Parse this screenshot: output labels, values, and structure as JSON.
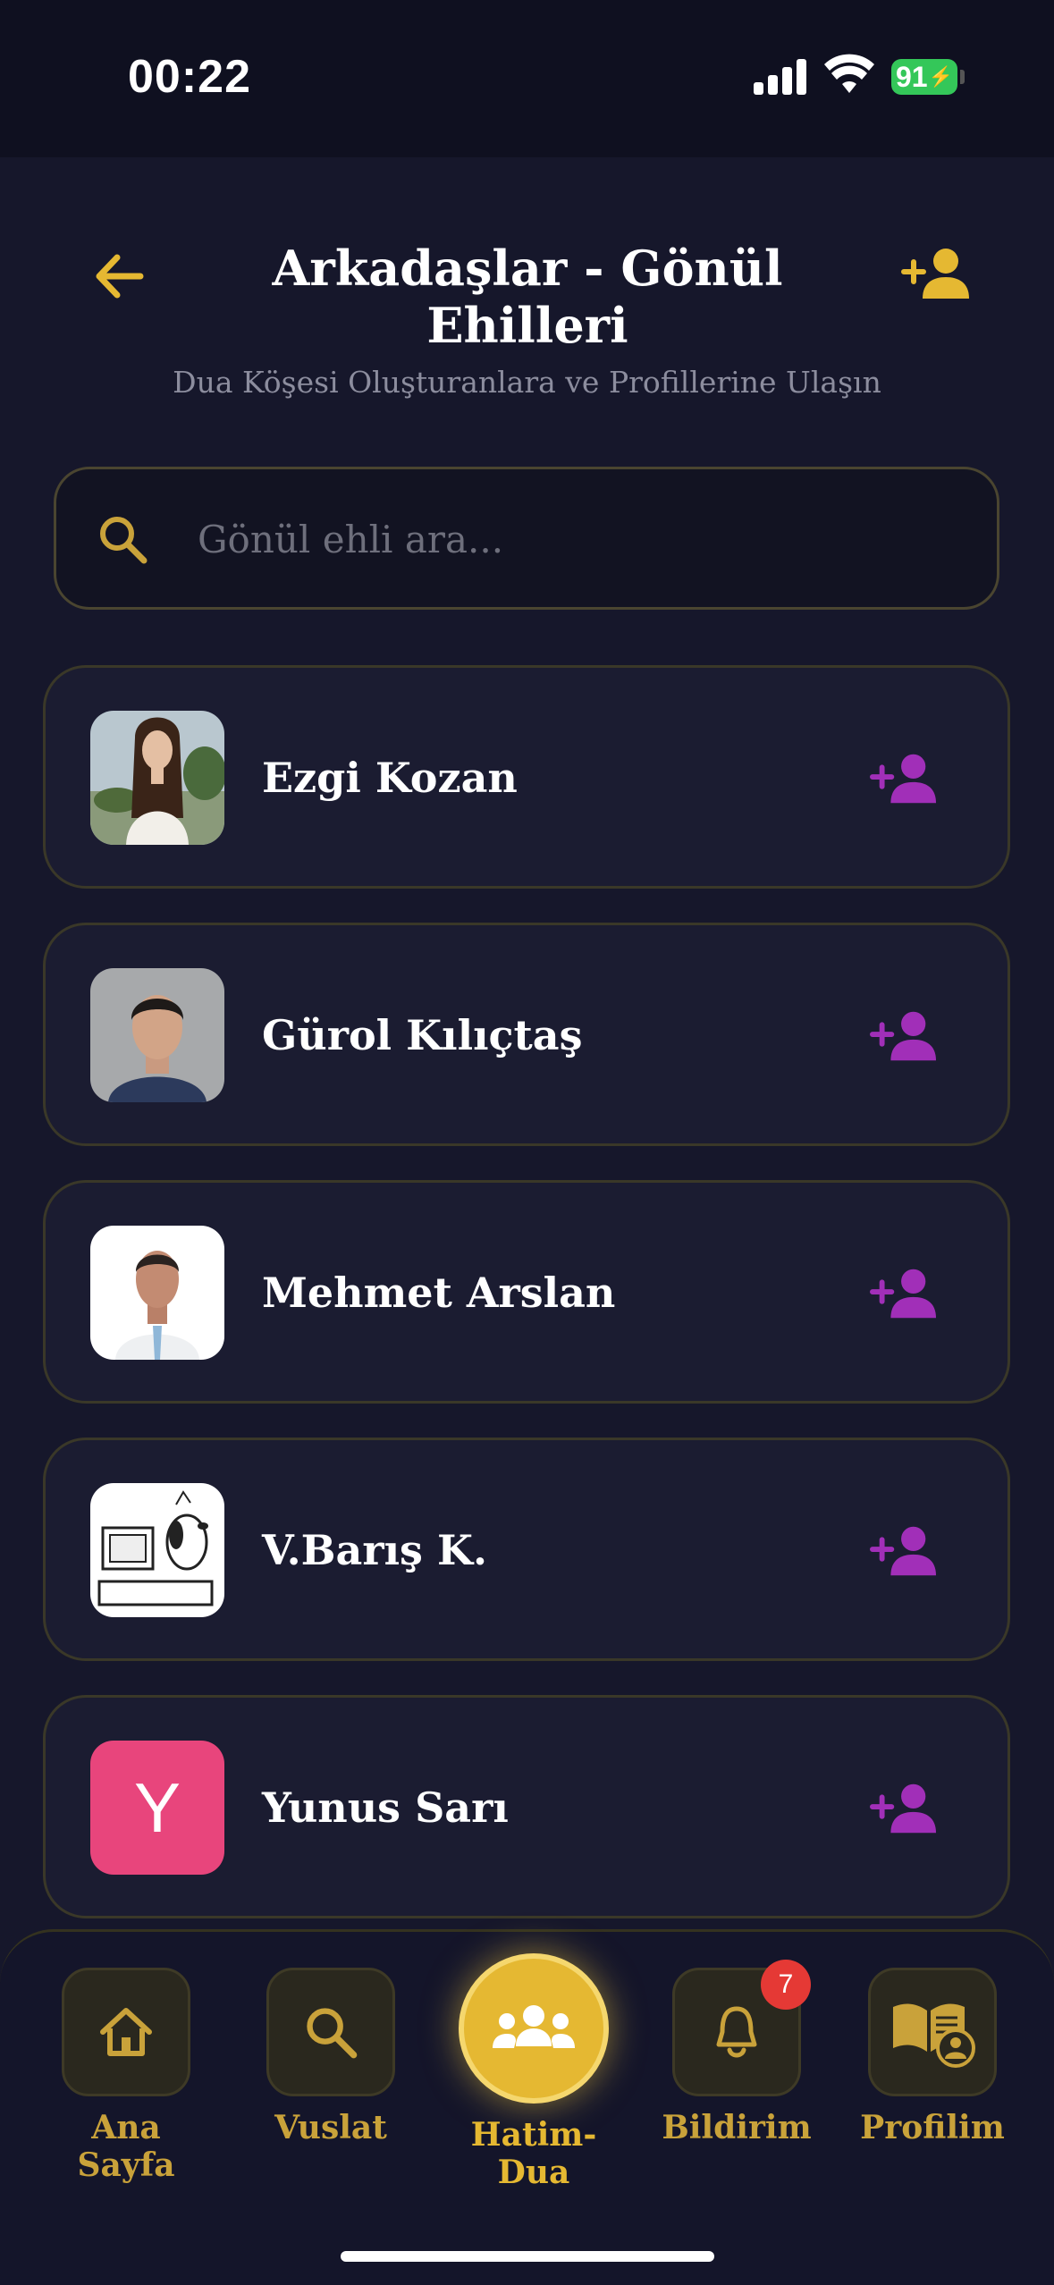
{
  "status_bar": {
    "time": "00:22",
    "battery": "91"
  },
  "header": {
    "title": "Arkadaşlar - Gönül Ehilleri",
    "subtitle": "Dua Köşesi Oluşturanlara ve Profillerine Ulaşın"
  },
  "search": {
    "placeholder": "Gönül ehli ara...",
    "value": ""
  },
  "friends": [
    {
      "name": "Ezgi Kozan",
      "avatar": "photo"
    },
    {
      "name": "Gürol Kılıçtaş",
      "avatar": "photo"
    },
    {
      "name": "Mehmet Arslan",
      "avatar": "photo"
    },
    {
      "name": "V.Barış K.",
      "avatar": "cartoon"
    },
    {
      "name": "Yunus Sarı",
      "avatar": "letter",
      "letter": "Y"
    }
  ],
  "nav": {
    "items": [
      {
        "label": "Ana Sayfa",
        "icon": "home-icon"
      },
      {
        "label": "Vuslat",
        "icon": "search-icon"
      },
      {
        "label": "Hatim-Dua",
        "icon": "group-icon",
        "active": true
      },
      {
        "label": "Bildirim",
        "icon": "bell-icon",
        "badge": "7"
      },
      {
        "label": "Profilim",
        "icon": "book-profile-icon"
      }
    ]
  },
  "colors": {
    "accent_gold": "#e5b832",
    "add_purple": "#a12fb8",
    "badge_red": "#e53935"
  }
}
